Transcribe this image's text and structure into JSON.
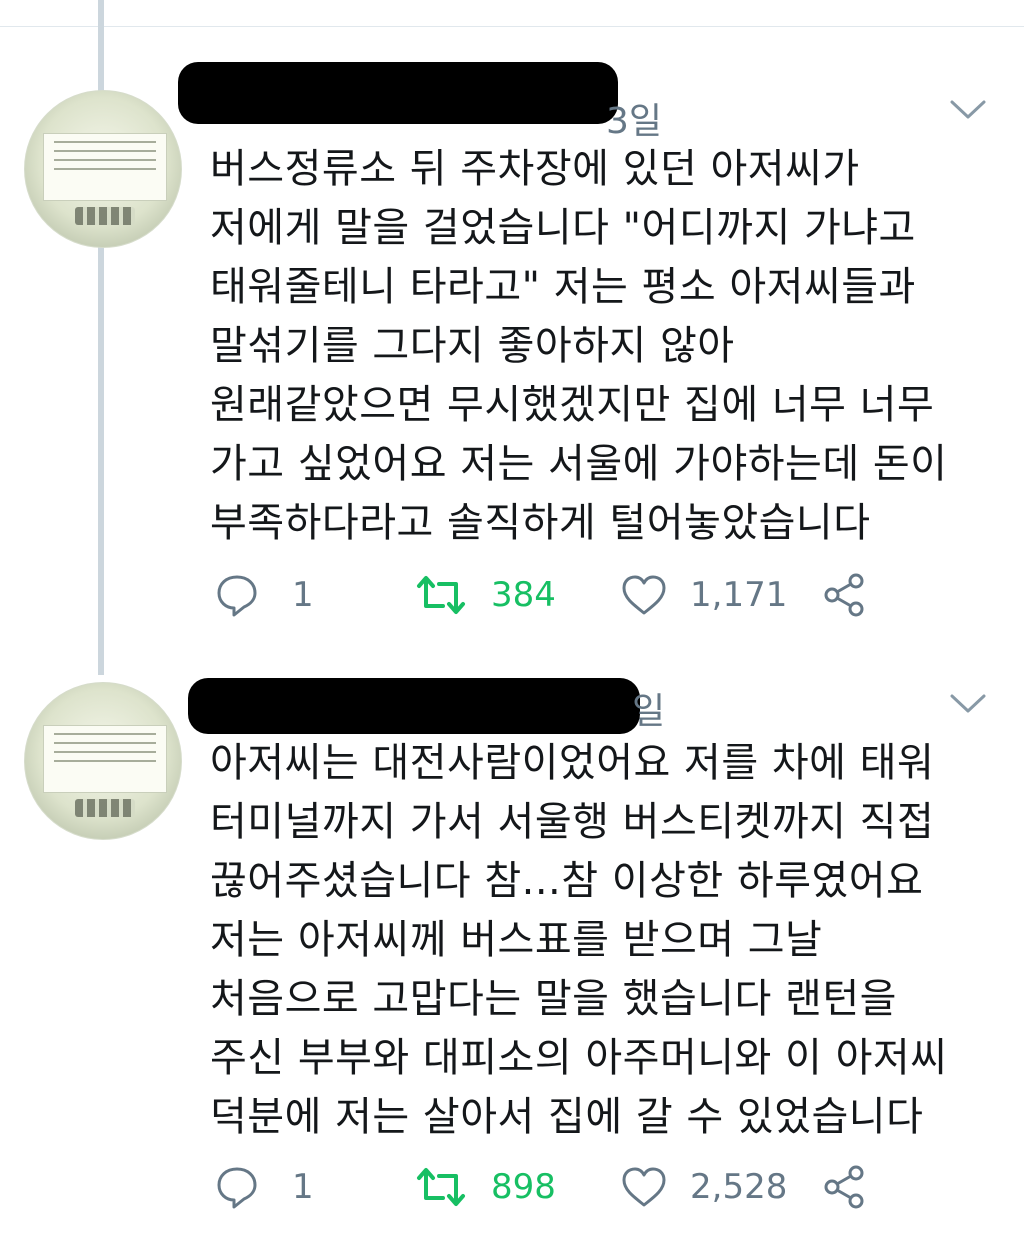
{
  "tweets": [
    {
      "time": "3일",
      "lines": [
        "버스정류소 뒤 주차장에 있던 아저씨가",
        "저에게 말을 걸었습니다 \"어디까지 가냐고",
        "태워줄테니 타라고\" 저는 평소 아저씨들과",
        "말섞기를 그다지 좋아하지 않아",
        "원래같았으면 무시했겠지만 집에 너무 너무",
        "가고 싶었어요 저는 서울에 가야하는데 돈이",
        "부족하다라고 솔직하게 털어놓았습니다"
      ],
      "replies": "1",
      "retweets": "384",
      "likes": "1,171"
    },
    {
      "time": "일",
      "lines": [
        "아저씨는 대전사람이었어요 저를 차에 태워",
        "터미널까지 가서 서울행 버스티켓까지 직접",
        "끊어주셨습니다 참...참 이상한 하루였어요",
        "저는 아저씨께 버스표를 받으며 그날",
        "처음으로 고맙다는 말을 했습니다 랜턴을",
        "주신 부부와 대피소의 아주머니와 이 아저씨",
        "덕분에 저는 살아서 집에 갈 수 있었습니다"
      ],
      "replies": "1",
      "retweets": "898",
      "likes": "2,528"
    }
  ],
  "colors": {
    "retweet": "#17bf63",
    "meta": "#657786",
    "text": "#14171a",
    "thread_line": "#ccd6dd"
  },
  "icons": [
    "reply-icon",
    "retweet-icon",
    "like-icon",
    "share-icon",
    "chevron-down-icon"
  ]
}
